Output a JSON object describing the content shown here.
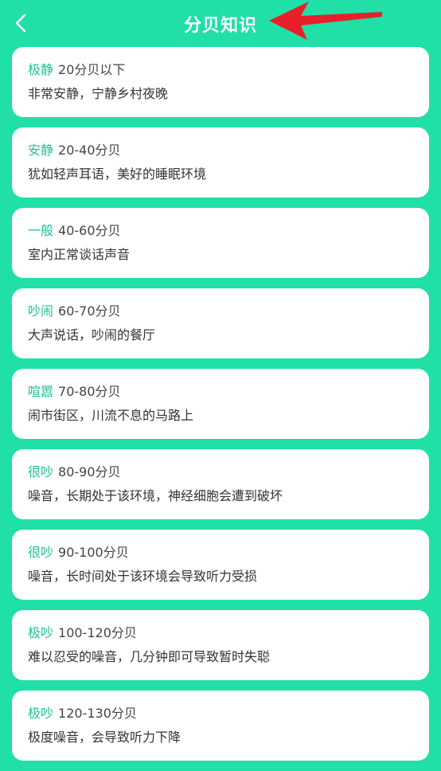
{
  "header": {
    "title": "分贝知识",
    "back_icon": "chevron-left-icon"
  },
  "annotation": {
    "arrow_color": "#e8202a"
  },
  "colors": {
    "background": "#20dfa7",
    "card": "#ffffff",
    "accent": "#20c09a"
  },
  "levels": [
    {
      "name": "极静",
      "range": "20分贝以下",
      "desc": "非常安静，宁静乡村夜晚"
    },
    {
      "name": "安静",
      "range": "20-40分贝",
      "desc": "犹如轻声耳语，美好的睡眠环境"
    },
    {
      "name": "一般",
      "range": "40-60分贝",
      "desc": "室内正常谈话声音"
    },
    {
      "name": "吵闹",
      "range": "60-70分贝",
      "desc": "大声说话，吵闹的餐厅"
    },
    {
      "name": "喧嚣",
      "range": "70-80分贝",
      "desc": "闹市街区，川流不息的马路上"
    },
    {
      "name": "很吵",
      "range": "80-90分贝",
      "desc": "噪音，长期处于该环境，神经细胞会遭到破坏"
    },
    {
      "name": "很吵",
      "range": "90-100分贝",
      "desc": "噪音，长时间处于该环境会导致听力受损"
    },
    {
      "name": "极吵",
      "range": "100-120分贝",
      "desc": "难以忍受的噪音，几分钟即可导致暂时失聪"
    },
    {
      "name": "极吵",
      "range": "120-130分贝",
      "desc": "极度噪音，会导致听力下降"
    }
  ]
}
